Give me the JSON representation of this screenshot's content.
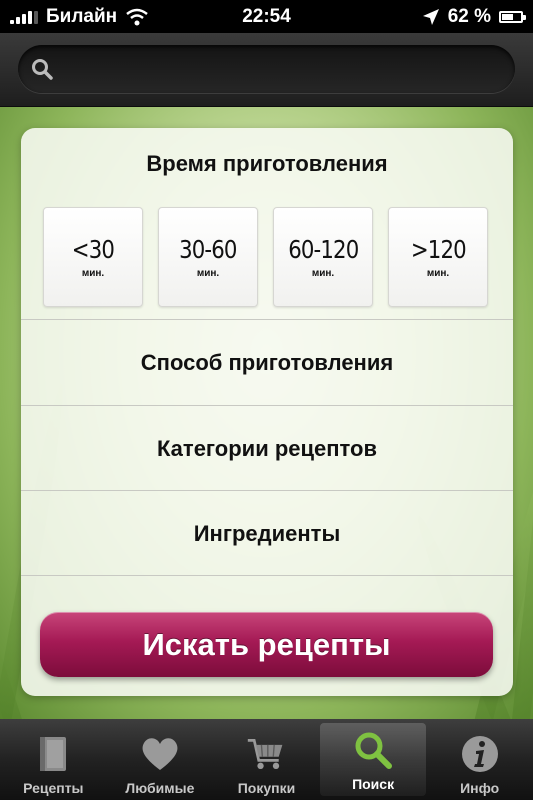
{
  "status_bar": {
    "carrier": "Билайн",
    "time": "22:54",
    "battery": "62 %",
    "battery_level": 0.62
  },
  "search": {
    "placeholder": ""
  },
  "cooking_time": {
    "title": "Время приготовления",
    "options": [
      {
        "value": "<30",
        "unit": "мин."
      },
      {
        "value": "30-60",
        "unit": "мин."
      },
      {
        "value": "60-120",
        "unit": "мин."
      },
      {
        "value": ">120",
        "unit": "мин."
      }
    ]
  },
  "sections": {
    "method": "Способ приготовления",
    "categories": "Категории рецептов",
    "ingredients": "Ингредиенты"
  },
  "search_button": "Искать рецепты",
  "tabs": [
    {
      "label": "Рецепты",
      "icon": "book-icon"
    },
    {
      "label": "Любимые",
      "icon": "heart-icon"
    },
    {
      "label": "Покупки",
      "icon": "cart-icon"
    },
    {
      "label": "Поиск",
      "icon": "search-icon",
      "active": true
    },
    {
      "label": "Инфо",
      "icon": "info-icon"
    }
  ],
  "colors": {
    "accent": "#a51a55",
    "search_tab_icon": "#7fc241"
  }
}
